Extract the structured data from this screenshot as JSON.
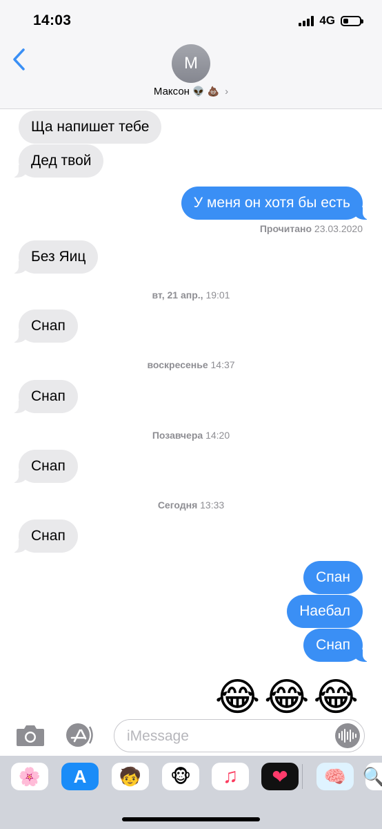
{
  "status": {
    "time": "14:03",
    "network": "4G",
    "battery_level": 0.3
  },
  "header": {
    "avatar_initial": "M",
    "contact_name": "Максон",
    "contact_emoji": "👽 💩",
    "chevron": "›"
  },
  "messages": [
    {
      "text": "Ща напишет тебе"
    },
    {
      "text": "Дед твой"
    },
    {
      "text": "У меня он хотя бы есть"
    },
    {
      "text": "Без Яиц"
    },
    {
      "text": "Снап"
    },
    {
      "text": "Снап"
    },
    {
      "text": "Снап"
    },
    {
      "text": "Снап"
    },
    {
      "text": "Спан"
    },
    {
      "text": "Наебал"
    },
    {
      "text": "Снап"
    }
  ],
  "read_receipt": {
    "label": "Прочитано",
    "date": "23.03.2020"
  },
  "timestamps": [
    {
      "day": "вт, 21 апр.,",
      "time": "19:01"
    },
    {
      "day": "воскресенье",
      "time": "14:37"
    },
    {
      "day": "Позавчера",
      "time": "14:20"
    },
    {
      "day": "Сегодня",
      "time": "13:33"
    }
  ],
  "emoji_message": "😂😂😂",
  "input": {
    "placeholder": "iMessage"
  },
  "app_drawer": [
    {
      "name": "photos",
      "glyph": "🌸"
    },
    {
      "name": "app-store",
      "glyph": "A"
    },
    {
      "name": "memoji",
      "glyph": "🧒"
    },
    {
      "name": "animoji",
      "glyph": "🐵"
    },
    {
      "name": "music",
      "glyph": "♫"
    },
    {
      "name": "digital-touch",
      "glyph": "❤"
    },
    {
      "name": "brain-app",
      "glyph": "🧠"
    },
    {
      "name": "more",
      "glyph": "🔍"
    }
  ]
}
